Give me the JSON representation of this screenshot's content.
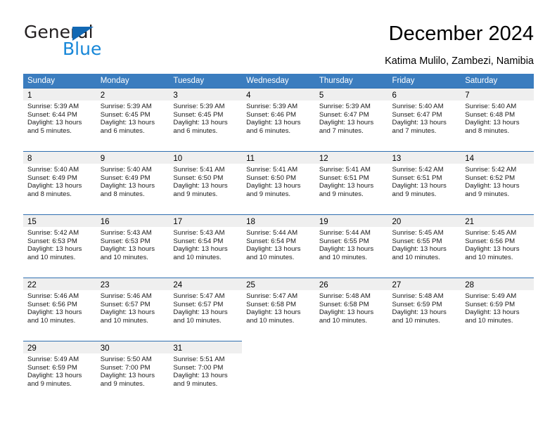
{
  "logo": {
    "primary_text": "General",
    "secondary_text": "Blue",
    "primary_color": "#231f20",
    "secondary_color": "#1787d8",
    "triangle_color": "#1268b3"
  },
  "header": {
    "title": "December 2024",
    "subtitle": "Katima Mulilo, Zambezi, Namibia"
  },
  "theme": {
    "header_bar_color": "#3b7dbf",
    "cell_top_border_color": "#2f6fb0",
    "day_band_color": "#efefef",
    "text_color": "#000000"
  },
  "calendar": {
    "weekdays": [
      "Sunday",
      "Monday",
      "Tuesday",
      "Wednesday",
      "Thursday",
      "Friday",
      "Saturday"
    ],
    "weeks": [
      [
        {
          "day": "1",
          "sunrise": "Sunrise: 5:39 AM",
          "sunset": "Sunset: 6:44 PM",
          "daylight": "Daylight: 13 hours and 5 minutes."
        },
        {
          "day": "2",
          "sunrise": "Sunrise: 5:39 AM",
          "sunset": "Sunset: 6:45 PM",
          "daylight": "Daylight: 13 hours and 6 minutes."
        },
        {
          "day": "3",
          "sunrise": "Sunrise: 5:39 AM",
          "sunset": "Sunset: 6:45 PM",
          "daylight": "Daylight: 13 hours and 6 minutes."
        },
        {
          "day": "4",
          "sunrise": "Sunrise: 5:39 AM",
          "sunset": "Sunset: 6:46 PM",
          "daylight": "Daylight: 13 hours and 6 minutes."
        },
        {
          "day": "5",
          "sunrise": "Sunrise: 5:39 AM",
          "sunset": "Sunset: 6:47 PM",
          "daylight": "Daylight: 13 hours and 7 minutes."
        },
        {
          "day": "6",
          "sunrise": "Sunrise: 5:40 AM",
          "sunset": "Sunset: 6:47 PM",
          "daylight": "Daylight: 13 hours and 7 minutes."
        },
        {
          "day": "7",
          "sunrise": "Sunrise: 5:40 AM",
          "sunset": "Sunset: 6:48 PM",
          "daylight": "Daylight: 13 hours and 8 minutes."
        }
      ],
      [
        {
          "day": "8",
          "sunrise": "Sunrise: 5:40 AM",
          "sunset": "Sunset: 6:49 PM",
          "daylight": "Daylight: 13 hours and 8 minutes."
        },
        {
          "day": "9",
          "sunrise": "Sunrise: 5:40 AM",
          "sunset": "Sunset: 6:49 PM",
          "daylight": "Daylight: 13 hours and 8 minutes."
        },
        {
          "day": "10",
          "sunrise": "Sunrise: 5:41 AM",
          "sunset": "Sunset: 6:50 PM",
          "daylight": "Daylight: 13 hours and 9 minutes."
        },
        {
          "day": "11",
          "sunrise": "Sunrise: 5:41 AM",
          "sunset": "Sunset: 6:50 PM",
          "daylight": "Daylight: 13 hours and 9 minutes."
        },
        {
          "day": "12",
          "sunrise": "Sunrise: 5:41 AM",
          "sunset": "Sunset: 6:51 PM",
          "daylight": "Daylight: 13 hours and 9 minutes."
        },
        {
          "day": "13",
          "sunrise": "Sunrise: 5:42 AM",
          "sunset": "Sunset: 6:51 PM",
          "daylight": "Daylight: 13 hours and 9 minutes."
        },
        {
          "day": "14",
          "sunrise": "Sunrise: 5:42 AM",
          "sunset": "Sunset: 6:52 PM",
          "daylight": "Daylight: 13 hours and 9 minutes."
        }
      ],
      [
        {
          "day": "15",
          "sunrise": "Sunrise: 5:42 AM",
          "sunset": "Sunset: 6:53 PM",
          "daylight": "Daylight: 13 hours and 10 minutes."
        },
        {
          "day": "16",
          "sunrise": "Sunrise: 5:43 AM",
          "sunset": "Sunset: 6:53 PM",
          "daylight": "Daylight: 13 hours and 10 minutes."
        },
        {
          "day": "17",
          "sunrise": "Sunrise: 5:43 AM",
          "sunset": "Sunset: 6:54 PM",
          "daylight": "Daylight: 13 hours and 10 minutes."
        },
        {
          "day": "18",
          "sunrise": "Sunrise: 5:44 AM",
          "sunset": "Sunset: 6:54 PM",
          "daylight": "Daylight: 13 hours and 10 minutes."
        },
        {
          "day": "19",
          "sunrise": "Sunrise: 5:44 AM",
          "sunset": "Sunset: 6:55 PM",
          "daylight": "Daylight: 13 hours and 10 minutes."
        },
        {
          "day": "20",
          "sunrise": "Sunrise: 5:45 AM",
          "sunset": "Sunset: 6:55 PM",
          "daylight": "Daylight: 13 hours and 10 minutes."
        },
        {
          "day": "21",
          "sunrise": "Sunrise: 5:45 AM",
          "sunset": "Sunset: 6:56 PM",
          "daylight": "Daylight: 13 hours and 10 minutes."
        }
      ],
      [
        {
          "day": "22",
          "sunrise": "Sunrise: 5:46 AM",
          "sunset": "Sunset: 6:56 PM",
          "daylight": "Daylight: 13 hours and 10 minutes."
        },
        {
          "day": "23",
          "sunrise": "Sunrise: 5:46 AM",
          "sunset": "Sunset: 6:57 PM",
          "daylight": "Daylight: 13 hours and 10 minutes."
        },
        {
          "day": "24",
          "sunrise": "Sunrise: 5:47 AM",
          "sunset": "Sunset: 6:57 PM",
          "daylight": "Daylight: 13 hours and 10 minutes."
        },
        {
          "day": "25",
          "sunrise": "Sunrise: 5:47 AM",
          "sunset": "Sunset: 6:58 PM",
          "daylight": "Daylight: 13 hours and 10 minutes."
        },
        {
          "day": "26",
          "sunrise": "Sunrise: 5:48 AM",
          "sunset": "Sunset: 6:58 PM",
          "daylight": "Daylight: 13 hours and 10 minutes."
        },
        {
          "day": "27",
          "sunrise": "Sunrise: 5:48 AM",
          "sunset": "Sunset: 6:59 PM",
          "daylight": "Daylight: 13 hours and 10 minutes."
        },
        {
          "day": "28",
          "sunrise": "Sunrise: 5:49 AM",
          "sunset": "Sunset: 6:59 PM",
          "daylight": "Daylight: 13 hours and 10 minutes."
        }
      ],
      [
        {
          "day": "29",
          "sunrise": "Sunrise: 5:49 AM",
          "sunset": "Sunset: 6:59 PM",
          "daylight": "Daylight: 13 hours and 9 minutes."
        },
        {
          "day": "30",
          "sunrise": "Sunrise: 5:50 AM",
          "sunset": "Sunset: 7:00 PM",
          "daylight": "Daylight: 13 hours and 9 minutes."
        },
        {
          "day": "31",
          "sunrise": "Sunrise: 5:51 AM",
          "sunset": "Sunset: 7:00 PM",
          "daylight": "Daylight: 13 hours and 9 minutes."
        },
        null,
        null,
        null,
        null
      ]
    ]
  }
}
